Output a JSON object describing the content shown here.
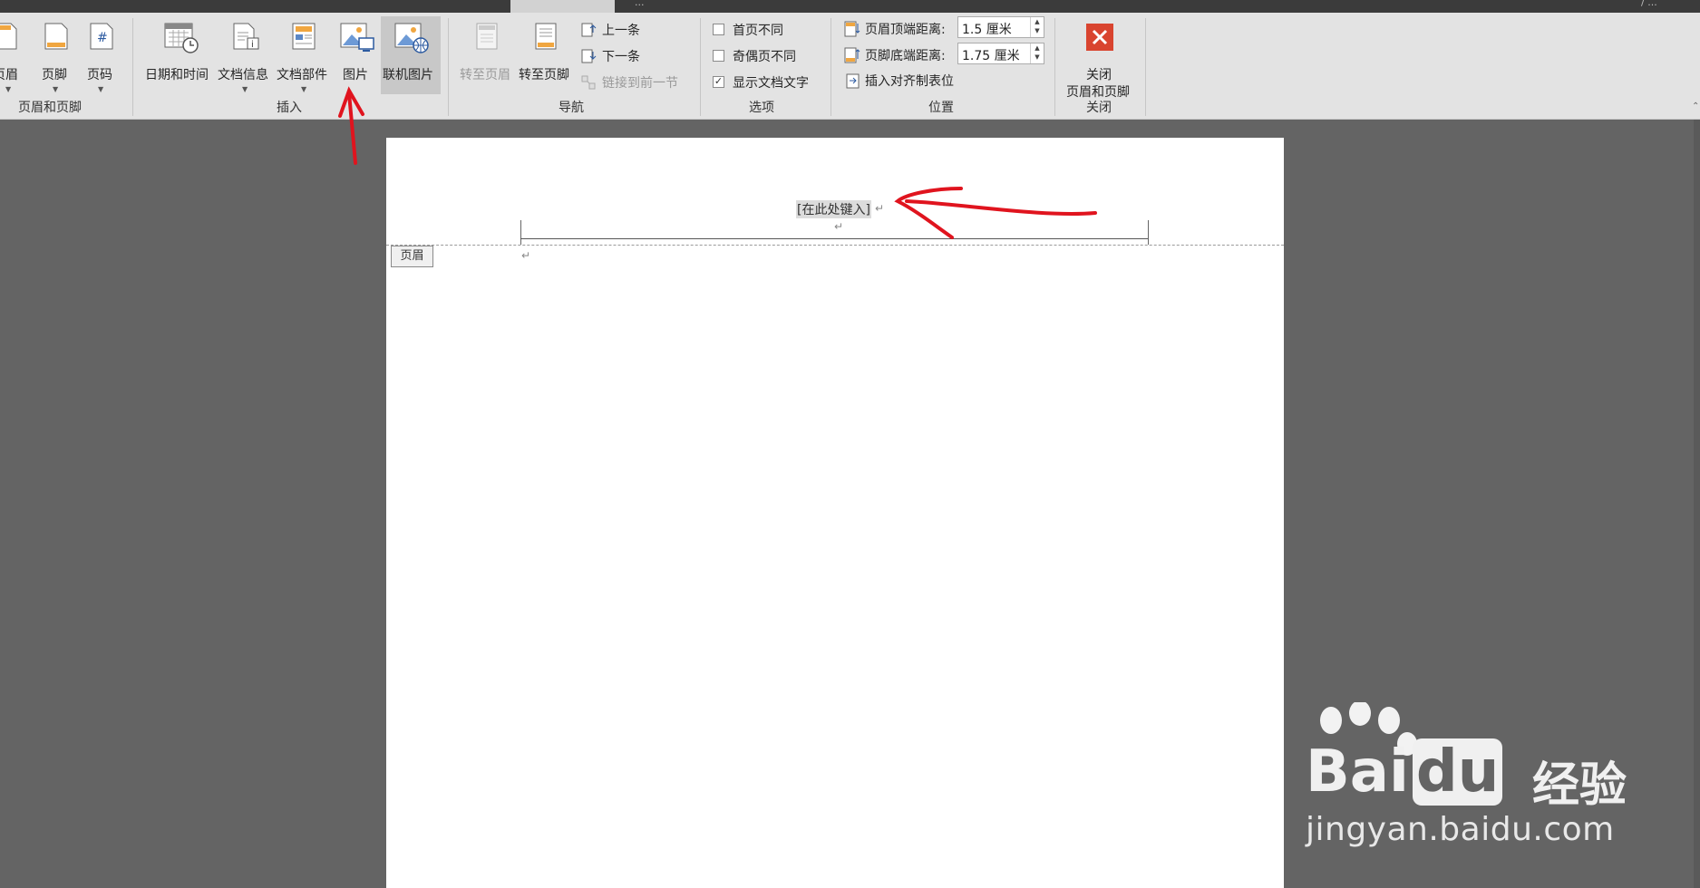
{
  "window": {
    "title": "...",
    "right_text": "/ ..."
  },
  "ribbon": {
    "header_footer_group": {
      "label": "页眉和页脚",
      "buttons": [
        {
          "label": "页眉",
          "icon": "header-icon"
        },
        {
          "label": "页脚",
          "icon": "footer-icon"
        },
        {
          "label": "页码",
          "icon": "page-number-icon",
          "glyph": "#"
        }
      ]
    },
    "insert_group": {
      "label": "插入",
      "buttons": [
        {
          "label": "日期和时间",
          "icon": "calendar-clock-icon"
        },
        {
          "label": "文档信息",
          "icon": "document-info-icon"
        },
        {
          "label": "文档部件",
          "icon": "quick-parts-icon"
        },
        {
          "label": "图片",
          "icon": "picture-icon"
        },
        {
          "label": "联机图片",
          "icon": "online-picture-icon"
        }
      ]
    },
    "navigation_group": {
      "label": "导航",
      "goto_header": "转至页眉",
      "goto_footer": "转至页脚",
      "previous": "上一条",
      "next": "下一条",
      "link_previous": "链接到前一节"
    },
    "options_group": {
      "label": "选项",
      "different_first_page": {
        "label": "首页不同",
        "checked": false
      },
      "different_odd_even": {
        "label": "奇偶页不同",
        "checked": false
      },
      "show_document_text": {
        "label": "显示文档文字",
        "checked": true
      }
    },
    "position_group": {
      "label": "位置",
      "header_top_label": "页眉顶端距离:",
      "header_top_value": "1.5 厘米",
      "footer_bottom_label": "页脚底端距离:",
      "footer_bottom_value": "1.75 厘米",
      "insert_align_tab": "插入对齐制表位"
    },
    "close_group": {
      "label": "关闭",
      "button_line1": "关闭",
      "button_line2": "页眉和页脚"
    }
  },
  "document": {
    "header_placeholder": "[在此处键入]",
    "header_tag": "页眉",
    "paragraph_mark": "↵"
  },
  "watermark": {
    "brand": "Bai",
    "brand2": "du",
    "brand_cn": "经验",
    "url": "jingyan.baidu.com"
  },
  "colors": {
    "ribbon_bg": "#e3e3e3",
    "workspace_bg": "#646464",
    "close_red": "#d9442f",
    "annotation_red": "#e0141e",
    "selected_btn": "#c8c8c8"
  }
}
